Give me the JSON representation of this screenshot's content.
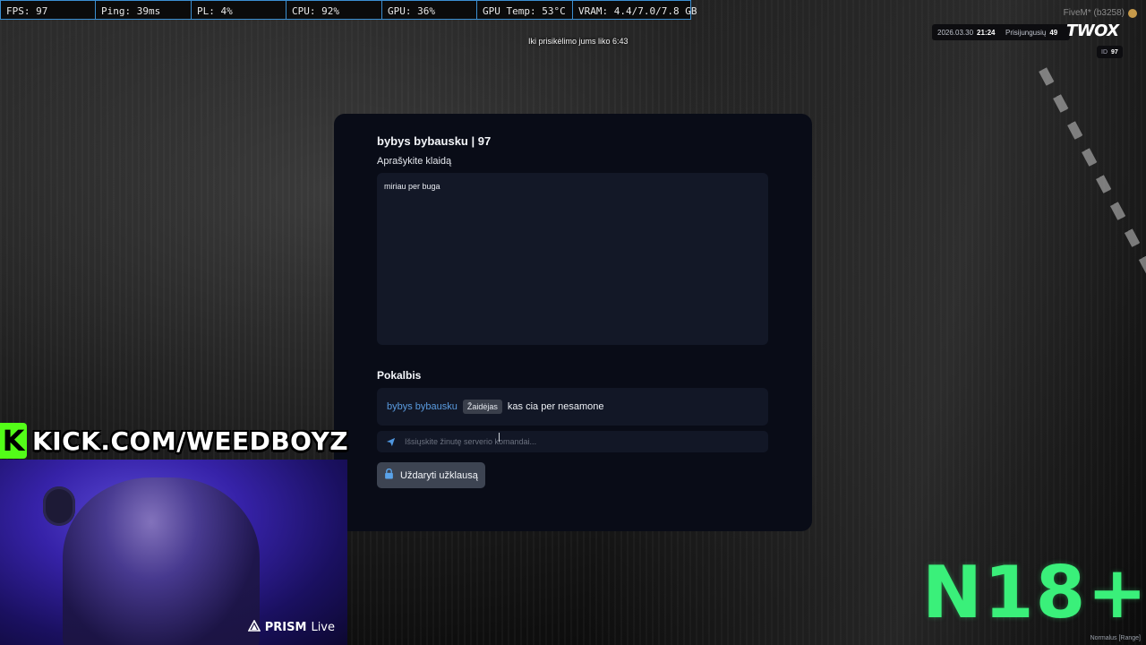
{
  "perf_bar": [
    {
      "label": "FPS: 97"
    },
    {
      "label": "Ping: 39ms"
    },
    {
      "label": "PL: 4%"
    },
    {
      "label": "CPU: 92%"
    },
    {
      "label": "GPU: 36%"
    },
    {
      "label": "GPU Temp: 53°C"
    },
    {
      "label": "VRAM: 4.4/7.0/7.8 GB"
    }
  ],
  "timer_text": "Iki prisikėlimo jums liko 6:43",
  "hud": {
    "fivem_label": "FiveM* (b3258)",
    "date": "2026.03.30",
    "time": "21:24",
    "online_label": "Prisijungusių",
    "online_count": "49",
    "brand": "TWOX",
    "id_label": "ID",
    "id_value": "97"
  },
  "modal": {
    "title": "bybys bybausku | 97",
    "description_label": "Aprašykite klaidą",
    "description_value": "miriau per buga",
    "chat_label": "Pokalbis",
    "messages": [
      {
        "author": "bybys bybausku",
        "role": "Žaidėjas",
        "text": "kas cia per nesamone"
      }
    ],
    "input_placeholder": "Išsiųskite žinutę serverio komandai...",
    "close_button_label": "Uždaryti užklausą"
  },
  "overlays": {
    "kick_logo": "K",
    "kick_text": "KICK.COM/WEEDBOYZ",
    "prism_brand": "PRISM",
    "prism_suffix": "Live",
    "rating": "N18+",
    "range_text": "Normalus [Range]"
  },
  "colors": {
    "perf_border": "#3b8fd1",
    "modal_bg": "#090c17",
    "field_bg": "#131827",
    "author": "#5a9bdf",
    "kick_green": "#53fc18",
    "rating_green": "#3af07a"
  },
  "icons": {
    "send": "paper-plane-icon",
    "close": "lock-icon",
    "prism": "triangle-icon"
  }
}
